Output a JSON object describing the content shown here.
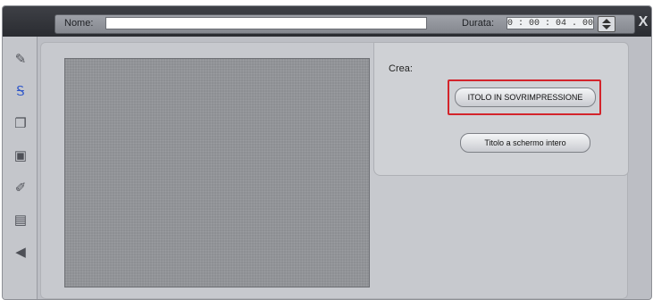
{
  "titlebar": {
    "name_label": "Nome:",
    "name_value": "",
    "duration_label": "Durata:",
    "duration_value": "0 : 00 : 04 . 00",
    "close_glyph": "X"
  },
  "toolbar": {
    "tools": [
      {
        "icon": "wand-icon",
        "glyph": "✎"
      },
      {
        "icon": "title-icon",
        "glyph": "Ꭶ"
      },
      {
        "icon": "layers-icon",
        "glyph": "❐"
      },
      {
        "icon": "image-icon",
        "glyph": "▣"
      },
      {
        "icon": "brush-icon",
        "glyph": "✐"
      },
      {
        "icon": "frame-icon",
        "glyph": "▤"
      },
      {
        "icon": "speaker-icon",
        "glyph": "◀"
      }
    ]
  },
  "create_panel": {
    "label": "Crea:",
    "overlay_title_button": "ITOLO IN SOVRIMPRESSIONE",
    "fullscreen_title_button": "Titolo a schermo intero"
  },
  "colors": {
    "highlight": "#d3242b",
    "active_tool": "#2e56c9"
  }
}
